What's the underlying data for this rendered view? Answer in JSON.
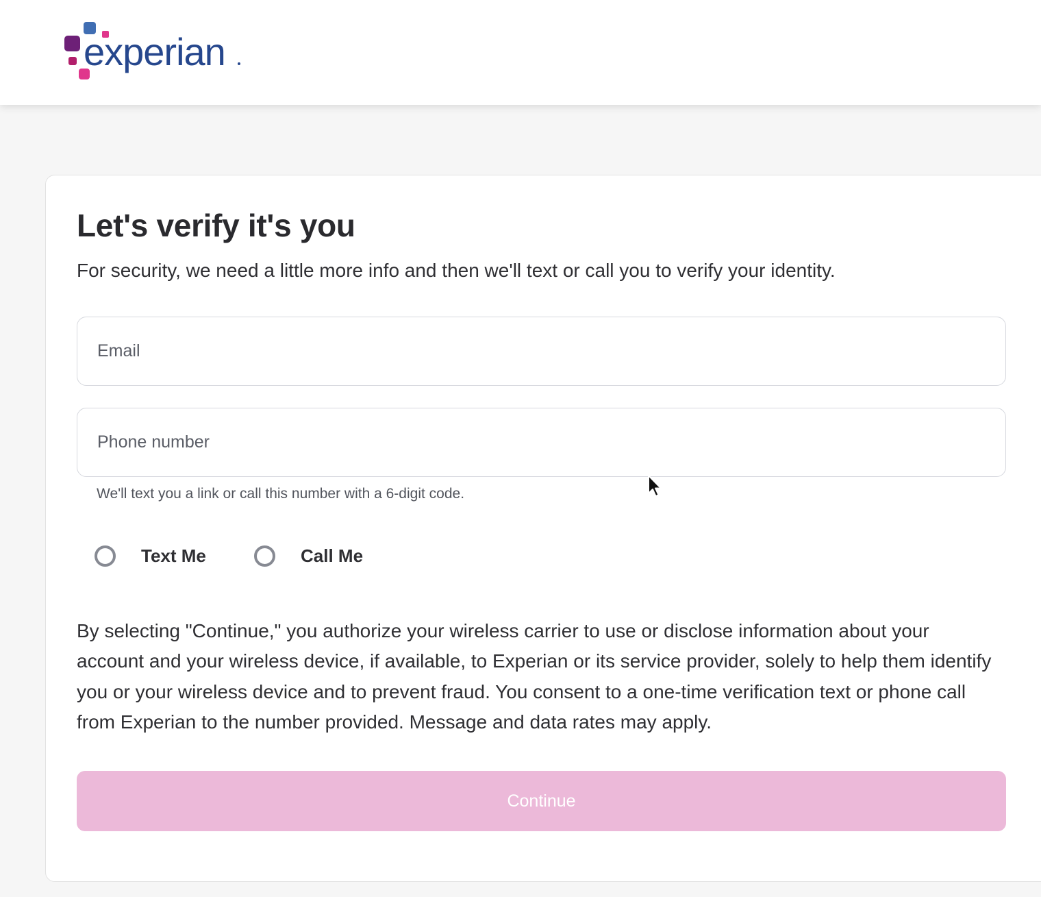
{
  "brand": {
    "name": "experian",
    "colors": {
      "primary_purple": "#6d2077",
      "magenta": "#e0368c",
      "blue": "#406eb3",
      "navy_text": "#26478d"
    }
  },
  "page": {
    "title": "Let's verify it's you",
    "subtitle": "For security, we need a little more info and then we'll text or call you to verify your identity."
  },
  "form": {
    "email": {
      "placeholder": "Email",
      "value": ""
    },
    "phone": {
      "placeholder": "Phone number",
      "value": "",
      "hint": "We'll text you a link or call this number with a 6-digit code."
    },
    "contact_method": {
      "options": [
        {
          "label": "Text Me",
          "selected": false
        },
        {
          "label": "Call Me",
          "selected": false
        }
      ]
    },
    "disclosure": "By selecting \"Continue,\" you authorize your wireless carrier to use or disclose information about your account and your wireless device, if available, to Experian or its service provider, solely to help them identify you or your wireless device and to prevent fraud. You consent to a one-time verification text or phone call from Experian to the number provided. Message and data rates may apply.",
    "continue_label": "Continue",
    "continue_enabled": false,
    "continue_color": "#ecb9d9"
  }
}
